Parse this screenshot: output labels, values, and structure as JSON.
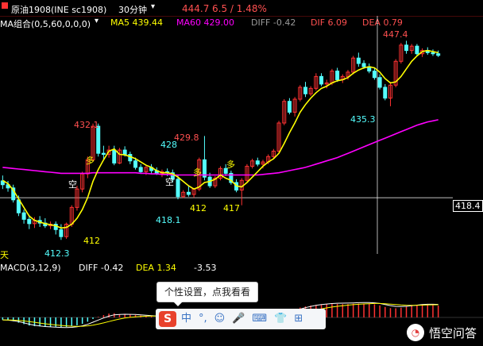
{
  "colors": {
    "up": "#ff3232",
    "down": "#54ffff",
    "ma5": "#ffff00",
    "ma60": "#ff00ff",
    "diff": "#ffffff",
    "dea": "#ffff00",
    "text_label": "#ffff00",
    "text_red": "#ff5050",
    "text_cyan": "#54ffff",
    "grid": "#8c1010"
  },
  "header": {
    "symbol": "原油1908(INE sc1908)",
    "period": "30分钟",
    "period_dropdown_icon": "chevron-down-icon",
    "last_price": "444.7",
    "change": "6.5 / 1.48%"
  },
  "ma_legend": {
    "name": "MA组合(0,5,60,0,0,0)",
    "ma5": "MA5 439.44",
    "ma60": "MA60 429.00",
    "diff": "DIFF -0.42",
    "dif": "DIF 6.09",
    "dea": "DEA 0.79"
  },
  "macd_legend": {
    "name": "MACD(3,12,9)",
    "diff": "DIFF -0.42",
    "dea": "DEA 1.34",
    "macd": "-3.53"
  },
  "right_price_label": "418.4",
  "annotations": {
    "p432": "432.1",
    "p428": "428",
    "p4298": "429.8",
    "p4181": "418.1",
    "p412a": "412",
    "p417": "417",
    "p4123": "412.3",
    "p412b": "412",
    "p4353": "435.3",
    "p4474": "447.4",
    "duo1": "多",
    "duo2": "多",
    "duo3": "多",
    "kong1": "空",
    "kong2": "空",
    "tian": "天"
  },
  "tooltip": "个性设置，点我看看",
  "ime_toolbar": {
    "logo": "S",
    "items": [
      "中",
      "°,",
      "☺",
      "🎤",
      "⌨",
      "👕",
      "⊞"
    ]
  },
  "watermark": "悟空问答",
  "chart_data": {
    "type": "candlestick",
    "ylim": [
      408,
      452
    ],
    "candles": [
      [
        421.5,
        422.5,
        420.0,
        420.8
      ],
      [
        420.8,
        421.5,
        419.5,
        420.2
      ],
      [
        420.2,
        420.8,
        417.5,
        418.0
      ],
      [
        418.0,
        418.8,
        415.0,
        415.6
      ],
      [
        415.6,
        416.2,
        413.6,
        414.4
      ],
      [
        414.4,
        415.2,
        412.6,
        413.6
      ],
      [
        413.6,
        414.8,
        412.8,
        414.2
      ],
      [
        414.2,
        415.0,
        413.0,
        413.7
      ],
      [
        413.7,
        414.6,
        412.8,
        413.2
      ],
      [
        413.2,
        414.0,
        412.6,
        413.5
      ],
      [
        413.5,
        414.0,
        411.6,
        412.5
      ],
      [
        412.5,
        413.5,
        410.6,
        411.2
      ],
      [
        411.2,
        413.8,
        410.8,
        413.5
      ],
      [
        413.5,
        417.0,
        413.0,
        416.6
      ],
      [
        416.6,
        420.6,
        416.0,
        420.0
      ],
      [
        420.0,
        423.2,
        419.4,
        422.8
      ],
      [
        422.8,
        426.0,
        422.0,
        425.4
      ],
      [
        425.4,
        432.1,
        425.0,
        431.6
      ],
      [
        431.6,
        432.1,
        426.0,
        426.6
      ],
      [
        426.6,
        428.0,
        425.5,
        426.4
      ],
      [
        426.4,
        428.0,
        425.8,
        427.2
      ],
      [
        427.2,
        428.0,
        424.4,
        424.8
      ],
      [
        424.8,
        427.6,
        424.6,
        427.2
      ],
      [
        427.2,
        427.9,
        426.0,
        426.4
      ],
      [
        426.4,
        426.9,
        424.6,
        425.2
      ],
      [
        425.2,
        425.8,
        423.6,
        424.0
      ],
      [
        424.0,
        424.6,
        422.8,
        423.2
      ],
      [
        423.2,
        424.4,
        422.6,
        424.0
      ],
      [
        424.0,
        424.6,
        422.8,
        423.4
      ],
      [
        423.4,
        424.0,
        422.6,
        422.8
      ],
      [
        422.8,
        423.6,
        422.2,
        423.2
      ],
      [
        423.2,
        423.8,
        422.4,
        423.0
      ],
      [
        423.0,
        423.6,
        421.2,
        421.8
      ],
      [
        421.8,
        422.6,
        418.1,
        418.6
      ],
      [
        418.6,
        419.8,
        418.3,
        419.4
      ],
      [
        419.4,
        420.6,
        418.6,
        419.0
      ],
      [
        419.0,
        420.2,
        418.4,
        420.0
      ],
      [
        420.0,
        425.8,
        419.6,
        425.4
      ],
      [
        425.4,
        429.8,
        421.6,
        422.2
      ],
      [
        422.2,
        423.0,
        420.2,
        420.6
      ],
      [
        420.6,
        422.4,
        420.2,
        422.0
      ],
      [
        422.0,
        424.2,
        421.6,
        423.8
      ],
      [
        423.8,
        424.6,
        422.4,
        422.9
      ],
      [
        422.9,
        423.4,
        420.8,
        421.2
      ],
      [
        421.2,
        421.8,
        419.4,
        419.8
      ],
      [
        419.8,
        422.0,
        417.0,
        421.6
      ],
      [
        421.6,
        424.6,
        421.4,
        424.2
      ],
      [
        424.2,
        425.6,
        423.8,
        425.2
      ],
      [
        425.2,
        425.8,
        424.2,
        424.6
      ],
      [
        424.6,
        425.4,
        423.8,
        425.0
      ],
      [
        425.0,
        426.4,
        424.6,
        426.0
      ],
      [
        426.0,
        427.4,
        425.6,
        427.0
      ],
      [
        427.0,
        432.6,
        426.6,
        432.2
      ],
      [
        432.2,
        436.6,
        431.8,
        436.2
      ],
      [
        436.2,
        436.8,
        433.8,
        434.2
      ],
      [
        434.2,
        437.0,
        433.4,
        436.6
      ],
      [
        436.6,
        439.2,
        436.2,
        438.8
      ],
      [
        438.8,
        439.8,
        437.0,
        437.6
      ],
      [
        437.6,
        439.0,
        437.2,
        438.6
      ],
      [
        438.6,
        441.4,
        438.2,
        440.8
      ],
      [
        440.8,
        441.4,
        439.0,
        439.4
      ],
      [
        439.4,
        440.2,
        438.6,
        439.6
      ],
      [
        439.6,
        442.2,
        439.2,
        441.8
      ],
      [
        441.8,
        442.4,
        439.8,
        440.2
      ],
      [
        440.2,
        441.2,
        439.6,
        440.8
      ],
      [
        440.8,
        442.0,
        440.2,
        441.6
      ],
      [
        441.6,
        444.6,
        441.2,
        444.2
      ],
      [
        444.2,
        445.2,
        442.6,
        443.2
      ],
      [
        443.2,
        443.8,
        442.2,
        442.6
      ],
      [
        442.6,
        443.2,
        441.4,
        441.8
      ],
      [
        441.8,
        442.4,
        440.2,
        440.6
      ],
      [
        440.6,
        441.2,
        438.4,
        438.8
      ],
      [
        438.8,
        439.4,
        436.4,
        436.8
      ],
      [
        436.8,
        439.8,
        435.3,
        439.2
      ],
      [
        439.2,
        444.0,
        438.8,
        443.6
      ],
      [
        443.6,
        447.0,
        443.2,
        446.6
      ],
      [
        446.6,
        447.4,
        445.0,
        445.6
      ],
      [
        445.6,
        446.8,
        445.0,
        446.4
      ],
      [
        446.4,
        446.8,
        444.6,
        445.0
      ],
      [
        445.0,
        446.0,
        444.4,
        445.6
      ],
      [
        445.6,
        446.2,
        444.8,
        445.2
      ],
      [
        445.2,
        445.8,
        444.6,
        445.0
      ],
      [
        445.0,
        445.6,
        444.4,
        444.7
      ]
    ],
    "ma5": [
      421.6,
      421.0,
      419.8,
      418.2,
      416.6,
      415.0,
      414.2,
      413.9,
      413.6,
      413.4,
      413.2,
      412.8,
      412.9,
      413.5,
      414.6,
      416.2,
      418.4,
      421.4,
      423.6,
      425.4,
      427.0,
      427.4,
      426.4,
      426.3,
      426.0,
      425.6,
      425.0,
      424.4,
      424.0,
      423.4,
      423.0,
      423.0,
      422.8,
      422.2,
      421.4,
      420.6,
      420.0,
      420.4,
      421.2,
      421.4,
      421.8,
      422.6,
      422.0,
      421.6,
      420.6,
      420.4,
      421.2,
      422.2,
      423.2,
      424.2,
      425.0,
      425.6,
      426.6,
      428.4,
      430.4,
      432.2,
      434.2,
      435.6,
      436.8,
      437.8,
      438.6,
      439.0,
      439.6,
      440.0,
      440.2,
      440.6,
      441.4,
      442.0,
      442.4,
      442.6,
      442.4,
      441.6,
      440.4,
      439.6,
      439.8,
      440.8,
      442.2,
      443.6,
      444.6,
      445.4,
      445.6,
      445.4,
      445.2
    ],
    "ma60": [
      424.0,
      423.9,
      423.8,
      423.7,
      423.6,
      423.5,
      423.4,
      423.3,
      423.2,
      423.1,
      423.0,
      422.9,
      422.9,
      422.9,
      422.9,
      422.9,
      422.9,
      423.0,
      423.0,
      423.0,
      423.0,
      423.0,
      423.0,
      423.0,
      423.0,
      423.0,
      422.9,
      422.9,
      422.8,
      422.8,
      422.7,
      422.7,
      422.6,
      422.6,
      422.6,
      422.6,
      422.6,
      422.6,
      422.6,
      422.6,
      422.6,
      422.6,
      422.6,
      422.6,
      422.6,
      422.6,
      422.6,
      422.6,
      422.6,
      422.7,
      422.8,
      422.9,
      423.0,
      423.2,
      423.4,
      423.6,
      423.8,
      424.0,
      424.3,
      424.6,
      424.9,
      425.2,
      425.5,
      425.8,
      426.2,
      426.6,
      427.0,
      427.4,
      427.8,
      428.2,
      428.6,
      429.0,
      429.4,
      429.8,
      430.2,
      430.6,
      431.0,
      431.4,
      431.8,
      432.1,
      432.4,
      432.6,
      432.8
    ]
  }
}
